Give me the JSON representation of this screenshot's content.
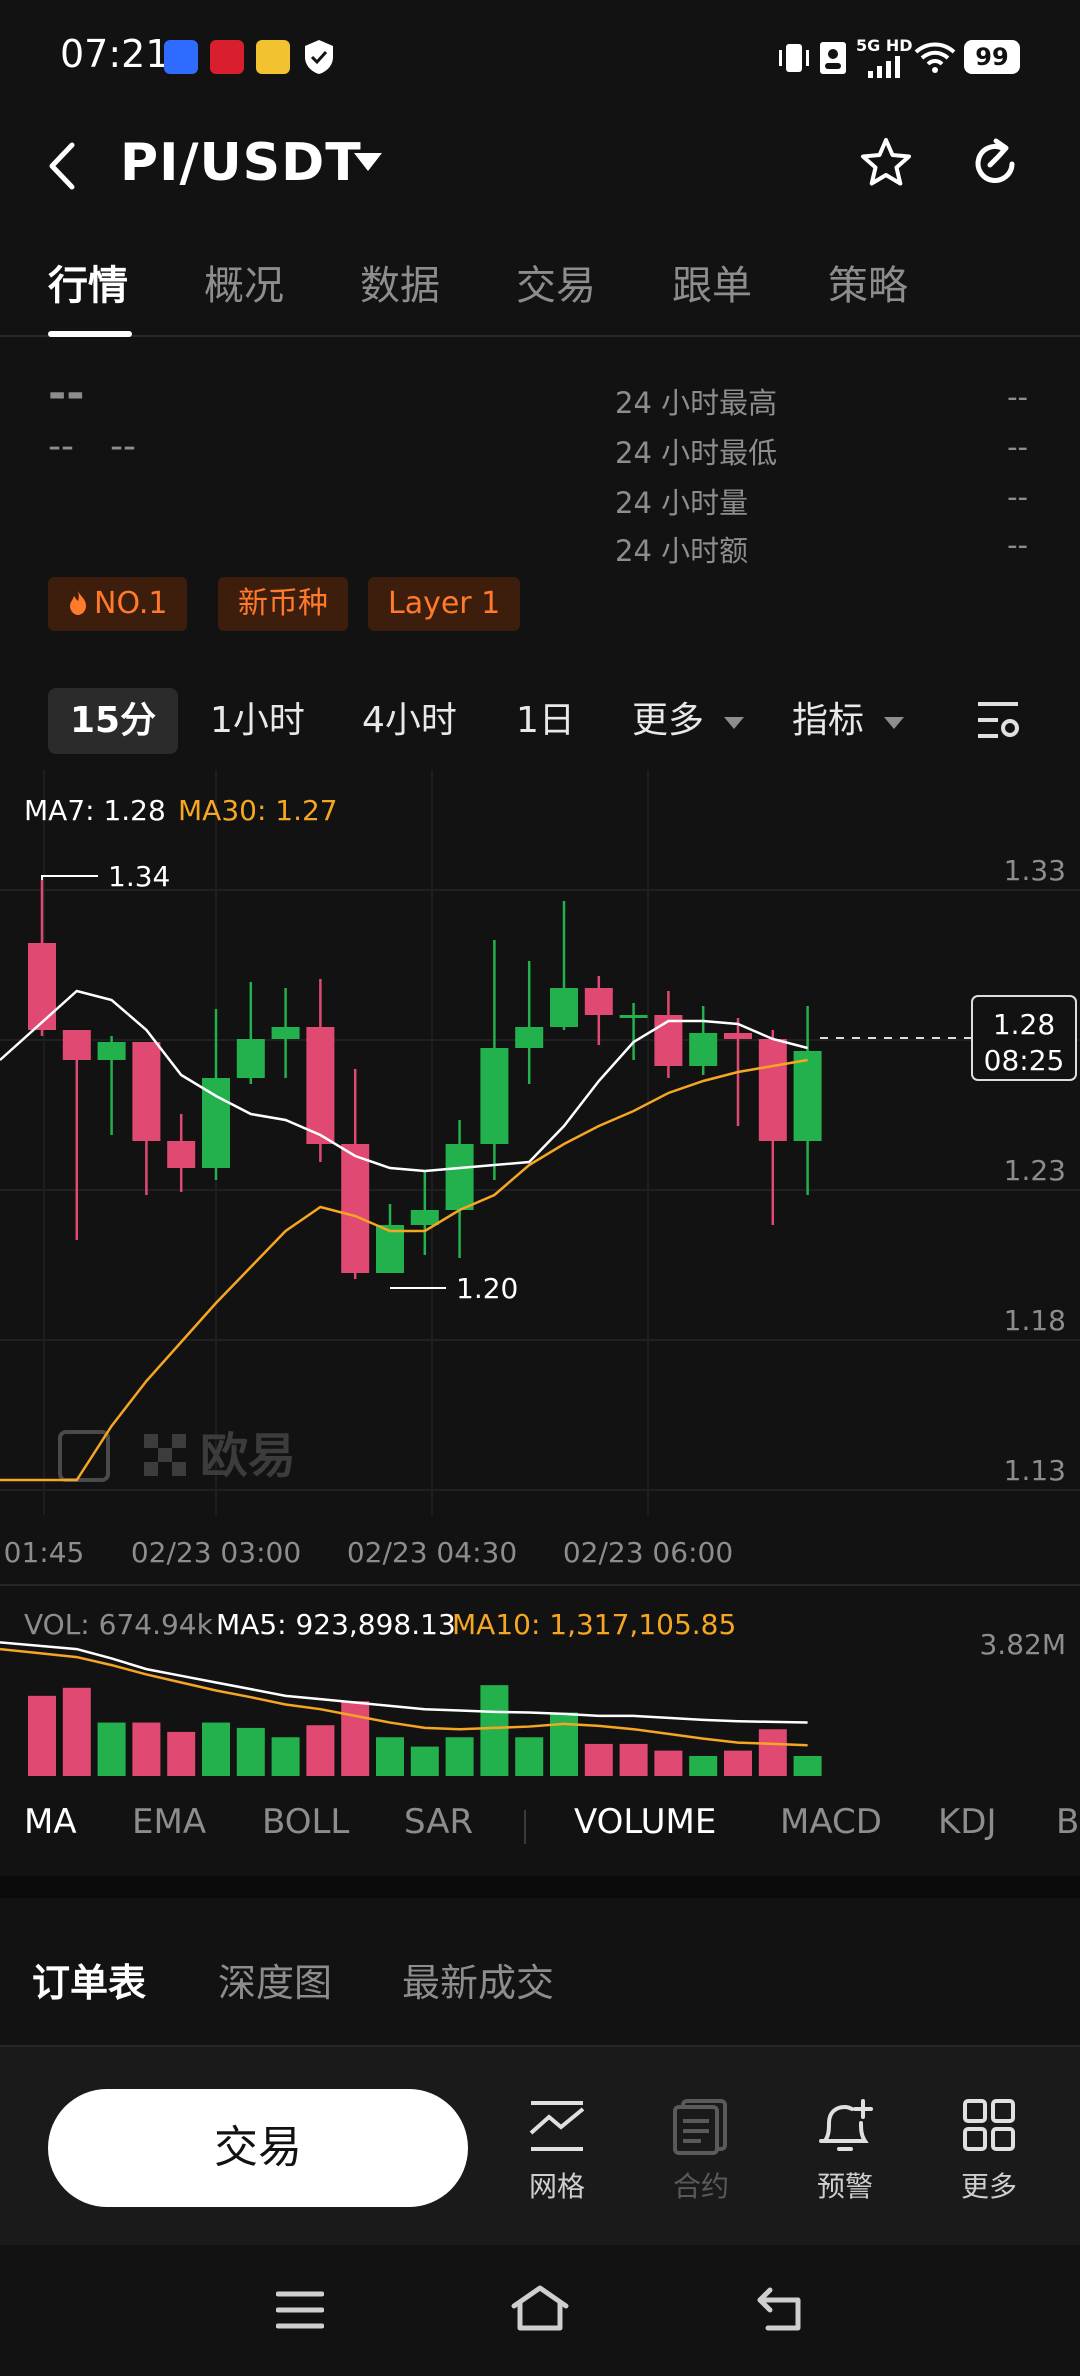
{
  "status_bar": {
    "time": "07:21",
    "network": "5G HD",
    "battery": "99"
  },
  "header": {
    "title": "PI/USDT",
    "icons": [
      "back-icon",
      "chevron-down-icon",
      "star-icon",
      "refresh-icon"
    ]
  },
  "tabs": [
    {
      "label": "行情",
      "active": true
    },
    {
      "label": "概况"
    },
    {
      "label": "数据"
    },
    {
      "label": "交易"
    },
    {
      "label": "跟单"
    },
    {
      "label": "策略"
    }
  ],
  "price_info": {
    "price": "--",
    "change_a": "--",
    "change_b": "--",
    "stats": [
      {
        "label": "24 小时最高",
        "value": "--"
      },
      {
        "label": "24 小时最低",
        "value": "--"
      },
      {
        "label": "24 小时量",
        "value": "--"
      },
      {
        "label": "24 小时额",
        "value": "--"
      }
    ]
  },
  "tags": [
    "NO.1",
    "新币种",
    "Layer 1"
  ],
  "intervals": [
    {
      "label": "15分",
      "active": true
    },
    {
      "label": "1小时"
    },
    {
      "label": "4小时"
    },
    {
      "label": "1日"
    },
    {
      "label": "更多"
    },
    {
      "label": "指标"
    }
  ],
  "colors": {
    "up": "#22b14c",
    "down": "#e04a72",
    "ma7": "#ffffff",
    "ma30": "#f5a623",
    "tag_bg": "#3d1e0d",
    "tag_fg": "#ff7a2a"
  },
  "chart_data": {
    "type": "candlestick",
    "ma_labels": {
      "ma7": "MA7: 1.28",
      "ma30": "MA30: 1.27"
    },
    "y_ticks": [
      "1.33",
      "1.28",
      "1.23",
      "1.18",
      "1.13"
    ],
    "ylim": [
      1.13,
      1.33
    ],
    "x_ticks": [
      "01:45",
      "02/23 03:00",
      "02/23 04:30",
      "02/23 06:00"
    ],
    "high_label": "1.34",
    "low_label": "1.20",
    "current_price": {
      "price": "1.28",
      "time": "08:25",
      "value": 1.28
    },
    "watermark": "欧易",
    "candles": [
      {
        "o": 1.309,
        "h": 1.33,
        "l": 1.278,
        "c": 1.28
      },
      {
        "o": 1.28,
        "h": 1.269,
        "l": 1.21,
        "c": 1.27
      },
      {
        "o": 1.27,
        "h": 1.278,
        "l": 1.245,
        "c": 1.276
      },
      {
        "o": 1.276,
        "h": 1.276,
        "l": 1.225,
        "c": 1.243
      },
      {
        "o": 1.243,
        "h": 1.252,
        "l": 1.226,
        "c": 1.234
      },
      {
        "o": 1.234,
        "h": 1.287,
        "l": 1.23,
        "c": 1.264
      },
      {
        "o": 1.264,
        "h": 1.296,
        "l": 1.262,
        "c": 1.277
      },
      {
        "o": 1.277,
        "h": 1.294,
        "l": 1.264,
        "c": 1.281
      },
      {
        "o": 1.281,
        "h": 1.297,
        "l": 1.236,
        "c": 1.242
      },
      {
        "o": 1.242,
        "h": 1.267,
        "l": 1.197,
        "c": 1.199
      },
      {
        "o": 1.199,
        "h": 1.222,
        "l": 1.2,
        "c": 1.215
      },
      {
        "o": 1.215,
        "h": 1.233,
        "l": 1.205,
        "c": 1.22
      },
      {
        "o": 1.22,
        "h": 1.25,
        "l": 1.204,
        "c": 1.242
      },
      {
        "o": 1.242,
        "h": 1.31,
        "l": 1.23,
        "c": 1.274
      },
      {
        "o": 1.274,
        "h": 1.303,
        "l": 1.262,
        "c": 1.281
      },
      {
        "o": 1.281,
        "h": 1.323,
        "l": 1.28,
        "c": 1.294
      },
      {
        "o": 1.294,
        "h": 1.298,
        "l": 1.275,
        "c": 1.285
      },
      {
        "o": 1.285,
        "h": 1.289,
        "l": 1.27,
        "c": 1.285
      },
      {
        "o": 1.285,
        "h": 1.293,
        "l": 1.264,
        "c": 1.268
      },
      {
        "o": 1.268,
        "h": 1.288,
        "l": 1.265,
        "c": 1.279
      },
      {
        "o": 1.279,
        "h": 1.284,
        "l": 1.248,
        "c": 1.277
      },
      {
        "o": 1.277,
        "h": 1.28,
        "l": 1.215,
        "c": 1.243
      },
      {
        "o": 1.243,
        "h": 1.288,
        "l": 1.225,
        "c": 1.273
      }
    ],
    "ma7": [
      1.27,
      1.293,
      1.29,
      1.28,
      1.265,
      1.258,
      1.252,
      1.25,
      1.245,
      1.238,
      1.234,
      1.233,
      1.234,
      1.235,
      1.236,
      1.248,
      1.263,
      1.276,
      1.283,
      1.283,
      1.282,
      1.277,
      1.274
    ],
    "ma30": [
      1.13,
      1.13,
      1.148,
      1.163,
      1.176,
      1.189,
      1.201,
      1.213,
      1.221,
      1.218,
      1.213,
      1.213,
      1.22,
      1.225,
      1.235,
      1.242,
      1.248,
      1.253,
      1.259,
      1.263,
      1.266,
      1.268,
      1.27
    ],
    "volume_labels": {
      "vol": "VOL: 674.94k",
      "ma5": "MA5: 923,898.13",
      "ma10": "MA10: 1,317,105.85"
    },
    "volume_max_label": "3.82M",
    "volume": [
      1.2,
      1.32,
      0.8,
      0.8,
      0.66,
      0.8,
      0.72,
      0.58,
      0.76,
      1.12,
      0.58,
      0.44,
      0.58,
      1.36,
      0.58,
      0.95,
      0.48,
      0.48,
      0.38,
      0.3,
      0.38,
      0.7,
      0.3
    ],
    "volume_up": [
      false,
      false,
      true,
      false,
      false,
      true,
      true,
      true,
      false,
      false,
      true,
      true,
      true,
      true,
      true,
      true,
      false,
      false,
      false,
      true,
      false,
      false,
      true
    ],
    "vol_ma5": [
      2.0,
      1.9,
      1.76,
      1.6,
      1.5,
      1.4,
      1.3,
      1.2,
      1.15,
      1.1,
      1.05,
      1.0,
      0.98,
      0.96,
      0.95,
      0.93,
      0.9,
      0.9,
      0.87,
      0.84,
      0.82,
      0.81,
      0.8
    ],
    "vol_ma10": [
      1.9,
      1.78,
      1.66,
      1.52,
      1.4,
      1.28,
      1.18,
      1.07,
      1.0,
      0.9,
      0.8,
      0.72,
      0.7,
      0.72,
      0.74,
      0.78,
      0.75,
      0.7,
      0.63,
      0.56,
      0.5,
      0.48,
      0.46
    ],
    "volume_ylim": [
      0,
      3.82
    ]
  },
  "indicators": [
    {
      "label": "MA",
      "active": true
    },
    {
      "label": "EMA"
    },
    {
      "label": "BOLL"
    },
    {
      "label": "SAR"
    },
    {
      "label": "VOLUME",
      "active": true
    },
    {
      "label": "MACD"
    },
    {
      "label": "KDJ"
    },
    {
      "label": "B"
    }
  ],
  "order_tabs": [
    {
      "label": "订单表",
      "active": true
    },
    {
      "label": "深度图"
    },
    {
      "label": "最新成交"
    }
  ],
  "action_bar": {
    "trade_label": "交易",
    "actions": [
      {
        "label": "网格",
        "icon": "grid-chart-icon"
      },
      {
        "label": "合约",
        "icon": "contract-icon",
        "disabled": true
      },
      {
        "label": "预警",
        "icon": "bell-plus-icon"
      },
      {
        "label": "更多",
        "icon": "more-grid-icon"
      }
    ]
  }
}
